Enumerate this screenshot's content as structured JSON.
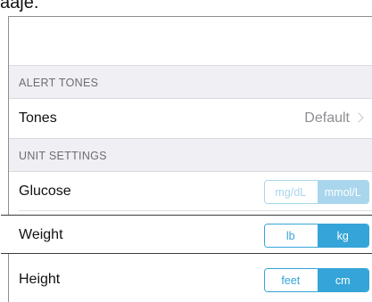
{
  "top_fragment": "aaje.",
  "sections": {
    "alert_tones": "ALERT TONES",
    "unit_settings": "UNIT SETTINGS"
  },
  "tones": {
    "label": "Tones",
    "value": "Default"
  },
  "glucose": {
    "label": "Glucose",
    "options": [
      "mg/dL",
      "mmol/L"
    ],
    "selected": "mmol/L"
  },
  "weight": {
    "label": "Weight",
    "options": [
      "lb",
      "kg"
    ],
    "selected": "kg"
  },
  "height": {
    "label": "Height",
    "options": [
      "feet",
      "cm"
    ],
    "selected": "cm"
  },
  "colors": {
    "accent": "#35a4d8",
    "header_bg": "#efeff4"
  }
}
